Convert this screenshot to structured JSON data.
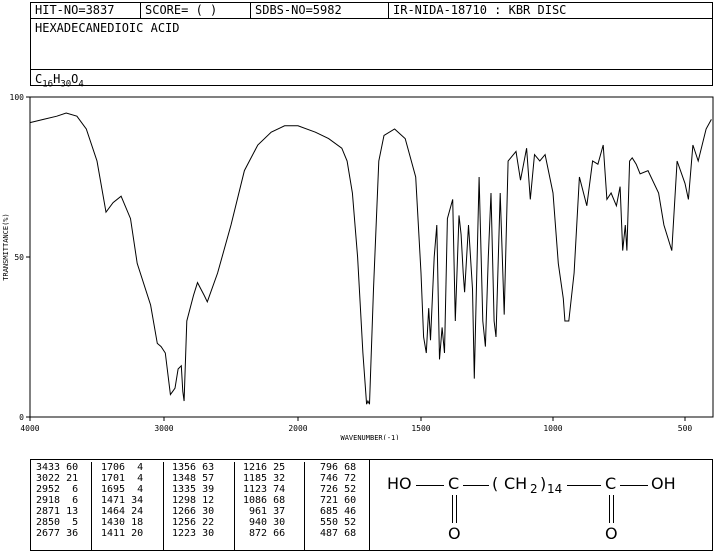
{
  "header": {
    "hit_no": "HIT-NO=3837",
    "score": "SCORE=  (  )",
    "sdbs_no": "SDBS-NO=5982",
    "ir_info": "IR-NIDA-18710 : KBR DISC",
    "compound_name": "HEXADECANEDIOIC ACID",
    "formula_parts": [
      "C",
      "16",
      "H",
      "30",
      "O",
      "4"
    ]
  },
  "chart_data": {
    "type": "line",
    "xlabel": "WAVENUMBER(-1)",
    "ylabel": "TRANSMITTANCE(%)",
    "xlim": [
      4000,
      400
    ],
    "ylim": [
      0,
      100
    ],
    "x_ticks": [
      "4000",
      "3000",
      "2000",
      "1500",
      "1000",
      "500"
    ],
    "y_ticks": [
      "0",
      "50",
      "100"
    ],
    "series": [
      {
        "x": [
          4000,
          3900,
          3800,
          3730,
          3650,
          3580,
          3500,
          3433,
          3380,
          3320,
          3250,
          3200,
          3100,
          3050,
          3022,
          2990,
          2952,
          2935,
          2918,
          2895,
          2871,
          2860,
          2850,
          2830,
          2780,
          2750,
          2700,
          2677,
          2600,
          2500,
          2400,
          2300,
          2200,
          2100,
          2000,
          1900,
          1850,
          1800,
          1780,
          1760,
          1740,
          1720,
          1706,
          1701,
          1695,
          1680,
          1660,
          1640,
          1600,
          1560,
          1520,
          1500,
          1490,
          1480,
          1471,
          1464,
          1450,
          1440,
          1430,
          1420,
          1411,
          1400,
          1380,
          1370,
          1356,
          1348,
          1340,
          1335,
          1320,
          1305,
          1298,
          1290,
          1280,
          1266,
          1256,
          1245,
          1235,
          1223,
          1216,
          1200,
          1185,
          1170,
          1140,
          1123,
          1100,
          1086,
          1070,
          1050,
          1030,
          1000,
          980,
          961,
          955,
          940,
          920,
          900,
          872,
          850,
          830,
          810,
          796,
          780,
          760,
          746,
          736,
          726,
          720,
          710,
          700,
          685,
          670,
          640,
          600,
          580,
          550,
          530,
          500,
          487,
          470,
          450,
          420,
          400
        ],
        "y": [
          92,
          93,
          94,
          95,
          94,
          90,
          80,
          64,
          67,
          69,
          62,
          48,
          35,
          23,
          22,
          20,
          7,
          8,
          9,
          15,
          16,
          8,
          5,
          30,
          38,
          42,
          38,
          36,
          45,
          60,
          77,
          85,
          89,
          91,
          91,
          89,
          87,
          84,
          80,
          70,
          50,
          20,
          4,
          5,
          4,
          40,
          80,
          88,
          90,
          87,
          75,
          45,
          25,
          20,
          34,
          24,
          50,
          60,
          18,
          28,
          20,
          62,
          68,
          30,
          63,
          57,
          45,
          39,
          60,
          40,
          12,
          40,
          75,
          30,
          22,
          50,
          70,
          30,
          25,
          70,
          32,
          80,
          83,
          74,
          84,
          68,
          82,
          80,
          82,
          70,
          48,
          37,
          30,
          30,
          45,
          75,
          66,
          80,
          79,
          85,
          68,
          70,
          66,
          72,
          52,
          60,
          52,
          80,
          81,
          79,
          76,
          77,
          70,
          60,
          52,
          80,
          73,
          68,
          85,
          80,
          90,
          93
        ]
      }
    ]
  },
  "peak_table": [
    [
      "3433 60",
      "3022 21",
      "2952  6",
      "2918  6",
      "2871 13",
      "2850  5",
      "2677 36"
    ],
    [
      "1706  4",
      "1701  4",
      "1695  4",
      "1471 34",
      "1464 24",
      "1430 18",
      "1411 20"
    ],
    [
      "1356 63",
      "1348 57",
      "1335 39",
      "1298 12",
      "1266 30",
      "1256 22",
      "1223 30"
    ],
    [
      "1216 25",
      "1185 32",
      "1123 74",
      "1086 68",
      " 961 37",
      " 940 30",
      " 872 66"
    ],
    [
      " 796 68",
      " 746 72",
      " 726 52",
      " 721 60",
      " 685 46",
      " 550 52",
      " 487 68"
    ]
  ],
  "structure": {
    "left_group": "HO",
    "carbon": "C",
    "chain_open": "(",
    "chain_unit": "CH",
    "chain_h_sub": "2",
    "chain_close": ")",
    "chain_repeat_sub": "14",
    "right_group": "OH",
    "oxygen": "O"
  }
}
